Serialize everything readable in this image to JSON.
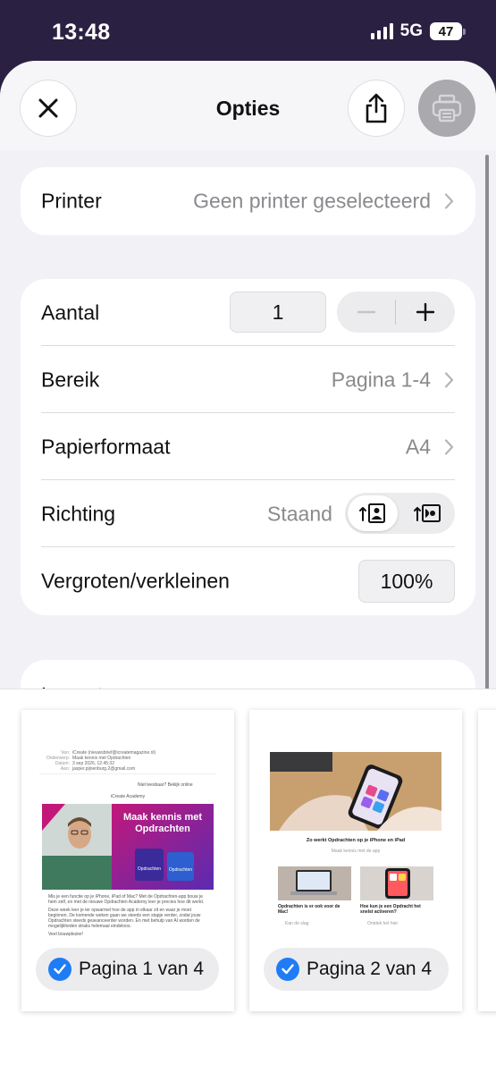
{
  "status_bar": {
    "time": "13:48",
    "network": "5G",
    "battery": "47"
  },
  "nav": {
    "title": "Opties"
  },
  "printer": {
    "label": "Printer",
    "value": "Geen printer geselecteerd"
  },
  "options": {
    "copies_label": "Aantal",
    "copies_value": "1",
    "range_label": "Bereik",
    "range_value": "Pagina 1-4",
    "paper_label": "Papierformaat",
    "paper_value": "A4",
    "orientation_label": "Richting",
    "orientation_value": "Staand",
    "scale_label": "Vergroten/verkleinen",
    "scale_value": "100%"
  },
  "next_section": {
    "label": "Layout"
  },
  "pages": [
    {
      "label": "Pagina 1 van 4",
      "selected": true
    },
    {
      "label": "Pagina 2 van 4",
      "selected": true
    }
  ],
  "page1": {
    "header_rows": [
      {
        "k": "Van:",
        "v": "iCreate (nieuwsbrief@icreatemagazine.nl)"
      },
      {
        "k": "Onderwerp:",
        "v": "Maak kennis met Opdrachten"
      },
      {
        "k": "Datum:",
        "v": "3 sep 2026, 12:45:32"
      },
      {
        "k": "Aan:",
        "v": "jasper.pijnenburg.2@gmail.com"
      }
    ],
    "view_online": "Niet leesbaar? Bekijk online",
    "academy": "iCreate Academy",
    "hero_text_1": "Maak kennis met",
    "hero_text_2": "Opdrachten",
    "hero_ribbon": "iCreate Academy",
    "hero_box_1": "Opdrachten",
    "hero_box_2": "Opdrachten",
    "body_1": "Mis je een functie op je iPhone, iPad of Mac? Met de Opdrachten-app bouw je hem zelf, en met de nieuwe Opdrachten Academy leer je precies hoe dit werkt.",
    "body_2": "Deze week leer je ter opwarmel hoe de app in elkaar zit en waar je moet beginnen. De komende weken gaan we steeds een stapje verder, zodat jouw Opdrachten steeds geavanceerder worden. En met behulp van AI worden de mogelijkheden straks helemaal eindeloos.",
    "body_3": "Veel bouwplezier!"
  },
  "page2": {
    "title": "Zo werkt Opdrachten op je iPhone en iPad",
    "subtitle": "Maak kennis met de app",
    "caption_a": "Opdrachten is er ook voor de Mac!",
    "caption_b": "Hoe kun je een Opdracht het snelst activeren?",
    "link_a": "Kan de slag",
    "link_b": "Ontdek het hier"
  },
  "colors": {
    "accent": "#1f7cf5",
    "status_bg": "#2a2142",
    "hero_pink": "#c2187a",
    "hero_purple": "#5a2bb0"
  }
}
